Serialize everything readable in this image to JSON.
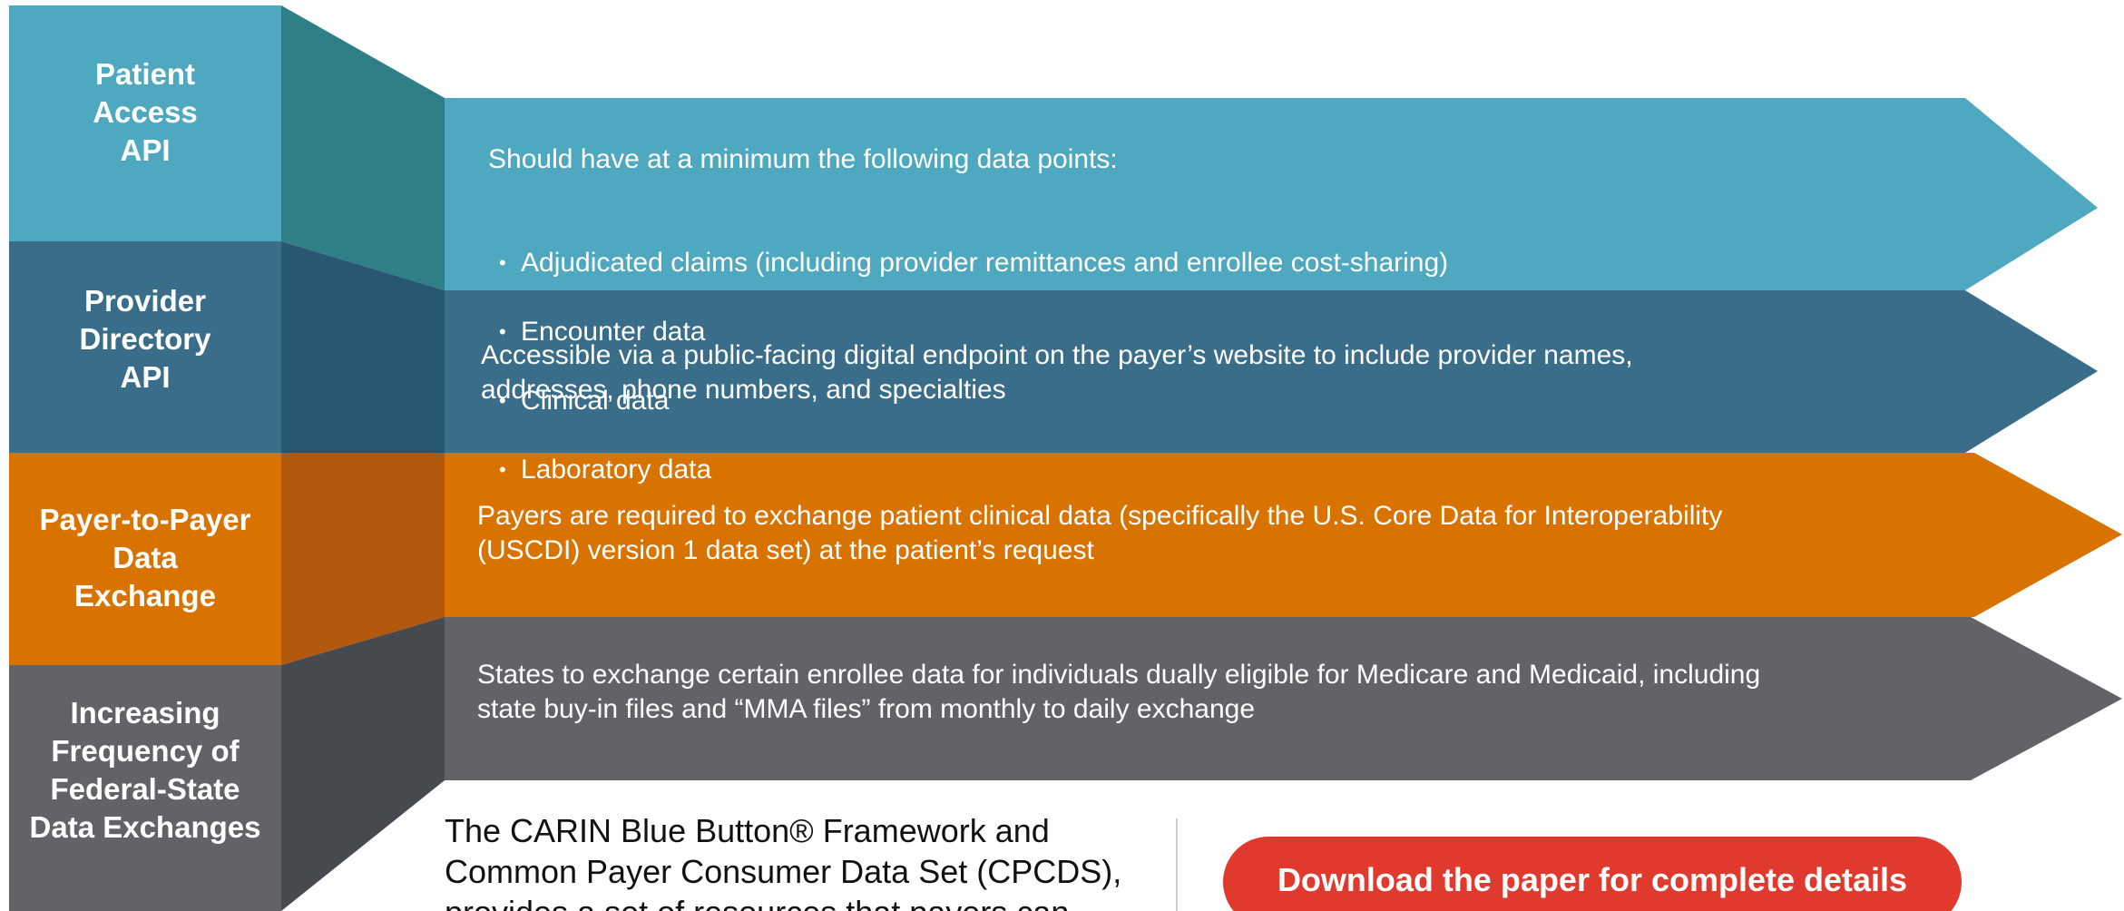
{
  "colors": {
    "teal": "#4ea8bf",
    "teal_dark": "#2e7f88",
    "steel": "#396d8a",
    "steel_dark": "#285771",
    "orange": "#d87300",
    "orange_dark": "#b3590d",
    "gray": "#616367",
    "gray_dark": "#46494d",
    "button": "#e03a2f"
  },
  "rows": [
    {
      "label": "Patient\nAccess\nAPI",
      "intro": "Should have at a minimum the following data points:",
      "bullets": [
        "Adjudicated claims (including provider remittances and enrollee cost-sharing)",
        "Encounter data",
        "Clinical data",
        "Laboratory data"
      ]
    },
    {
      "label": "Provider\nDirectory\nAPI",
      "description": "Accessible via a public-facing digital endpoint on the payer’s website to include provider names,\naddresses, phone numbers, and specialties"
    },
    {
      "label": "Payer-to-Payer\nData\nExchange",
      "description": "Payers are required to exchange patient clinical data (specifically the U.S. Core Data for Interoperability\n(USCDI) version 1 data set) at the patient’s request"
    },
    {
      "label": "Increasing\nFrequency of\nFederal-State\nData Exchanges",
      "description": "States to exchange certain enrollee data for individuals dually eligible for Medicare and Medicaid, including\nstate buy-in files and “MMA files” from monthly to daily exchange"
    }
  ],
  "footer": {
    "text": "The CARIN Blue Button® Framework and Common Payer Consumer Data Set (CPCDS), provides a set of resources that payers can",
    "download_label": "Download the paper for complete details"
  }
}
